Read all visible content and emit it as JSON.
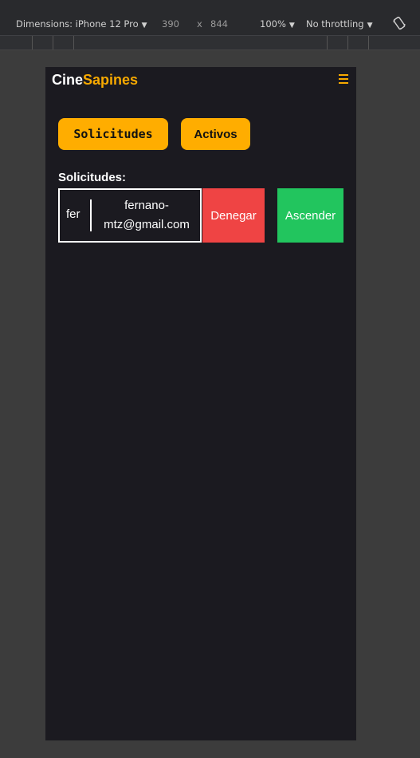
{
  "devtools": {
    "dimensions_label": "Dimensions: iPhone 12 Pro",
    "width": "390",
    "times": "x",
    "height": "844",
    "zoom": "100%",
    "throttling": "No throttling"
  },
  "brand": {
    "part1": "Cine",
    "part2": "Sapines"
  },
  "buttons": {
    "solicitudes": "Solicitudes",
    "activos": "Activos"
  },
  "section": {
    "title": "Solicitudes:"
  },
  "requests": [
    {
      "name": "fer",
      "email": "fernano-mtz@gmail.com",
      "deny_label": "Denegar",
      "promote_label": "Ascender"
    }
  ],
  "colors": {
    "accent": "#ffad00",
    "deny": "#ef4444",
    "promote": "#22c55e",
    "background": "#1b1a20"
  }
}
